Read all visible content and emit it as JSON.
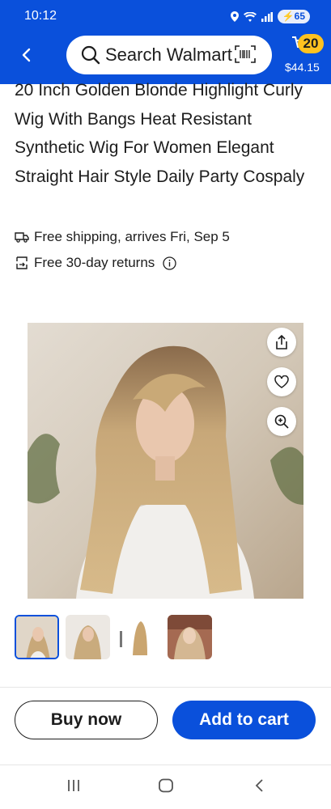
{
  "status_bar": {
    "time": "10:12",
    "battery": "65"
  },
  "header": {
    "search_placeholder": "Search Walmart",
    "cart_count": "20",
    "cart_total": "$44.15"
  },
  "product": {
    "title": "20 Inch Golden Blonde Highlight Curly Wig With Bangs Heat Resistant Synthetic Wig For Women Elegant Straight Hair Style Daily Party Cospaly",
    "shipping": "Free shipping, arrives Fri, Sep 5",
    "returns": "Free 30-day returns"
  },
  "actions": {
    "buy_now": "Buy now",
    "add_to_cart": "Add to cart"
  },
  "colors": {
    "brand_blue": "#0a50db",
    "spark_yellow": "#ffc220"
  },
  "icons": [
    "back-arrow-icon",
    "search-icon",
    "barcode-scan-icon",
    "truck-icon",
    "return-icon",
    "info-icon",
    "share-icon",
    "heart-icon",
    "zoom-icon",
    "recents-icon",
    "home-icon",
    "back-icon"
  ]
}
